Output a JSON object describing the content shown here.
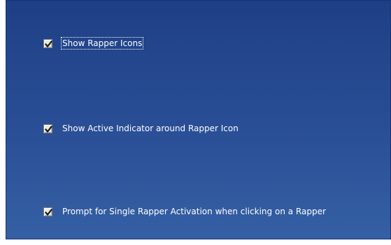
{
  "options": [
    {
      "label": "Show Rapper Icons",
      "checked": true,
      "focused": true
    },
    {
      "label": "Show Active Indicator around Rapper Icon",
      "checked": true,
      "focused": false
    },
    {
      "label": "Prompt for Single Rapper Activation when clicking on a Rapper",
      "checked": true,
      "focused": false
    }
  ],
  "icons": {
    "checkbox": "checkmark-icon"
  },
  "colors": {
    "panel_top": "#1e3f86",
    "panel_bottom": "#3560a4",
    "text": "#ffffff",
    "check": "#1a1a1a"
  }
}
